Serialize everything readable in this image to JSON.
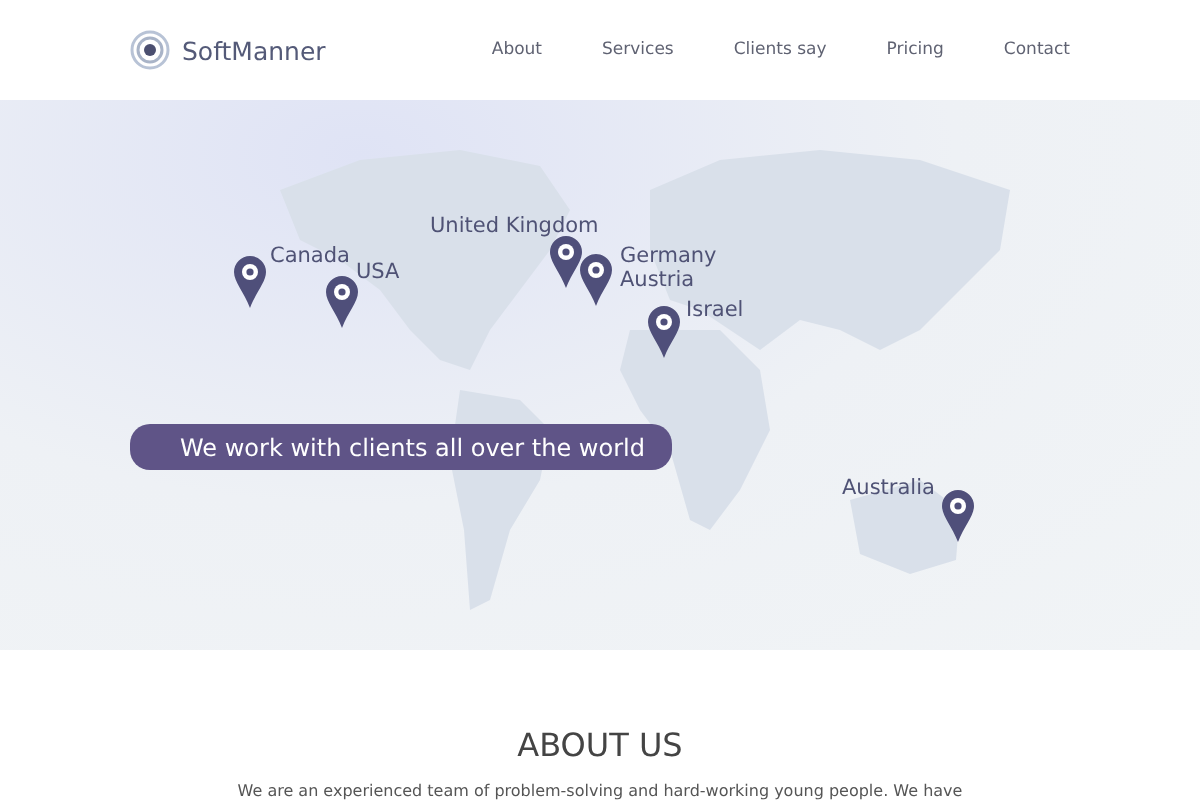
{
  "header": {
    "logo": {
      "name": "SoftManner"
    },
    "nav": [
      {
        "label": "About"
      },
      {
        "label": "Services"
      },
      {
        "label": "Clients say"
      },
      {
        "label": "Pricing"
      },
      {
        "label": "Contact"
      }
    ]
  },
  "map": {
    "locations": [
      {
        "label": "Canada"
      },
      {
        "label": "USA"
      },
      {
        "label": "United Kingdom"
      },
      {
        "label": "Germany"
      },
      {
        "label": "Austria"
      },
      {
        "label": "Israel"
      },
      {
        "label": "Australia"
      }
    ],
    "banner": "We work with clients all over the world"
  },
  "about": {
    "heading": "ABOUT US",
    "text": "We are an experienced team of problem-solving and hard-working young people. We have"
  }
}
